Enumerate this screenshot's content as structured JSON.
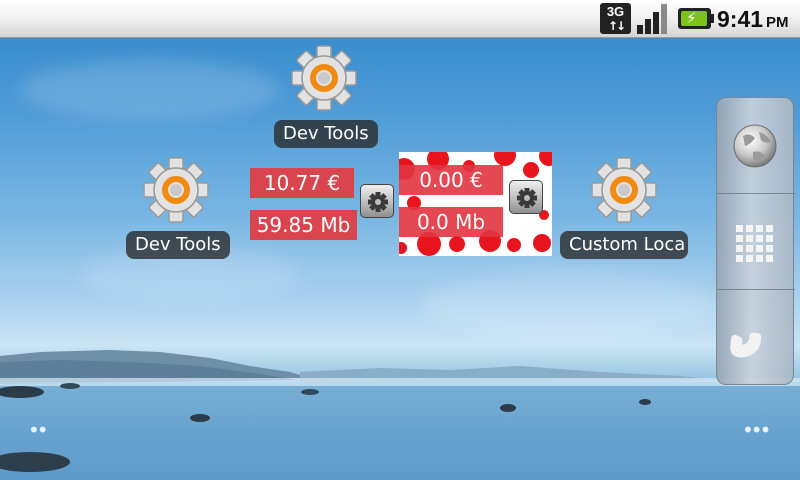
{
  "status_bar": {
    "network_type": "3G",
    "time": "9:41",
    "ampm": "PM",
    "icons": [
      "data-3g-icon",
      "signal-strength-icon",
      "battery-charging-icon"
    ],
    "battery_color": "#7dc318"
  },
  "shortcuts": [
    {
      "label": "Dev Tools",
      "icon": "gear-icon"
    },
    {
      "label": "Dev Tools",
      "icon": "gear-icon"
    },
    {
      "label": "Custom Loca",
      "icon": "gear-icon"
    }
  ],
  "widget_1": {
    "money": "10.77 €",
    "data": "59.85 Mb",
    "color": "#d9454f"
  },
  "widget_2": {
    "money": "0.00 €",
    "data": "0.0 Mb",
    "color": "#e03440"
  },
  "dock": {
    "items": [
      "browser-globe-icon",
      "app-drawer-grid-icon",
      "phone-icon"
    ]
  },
  "page_indicators": {
    "left": "••",
    "right": "•••"
  }
}
